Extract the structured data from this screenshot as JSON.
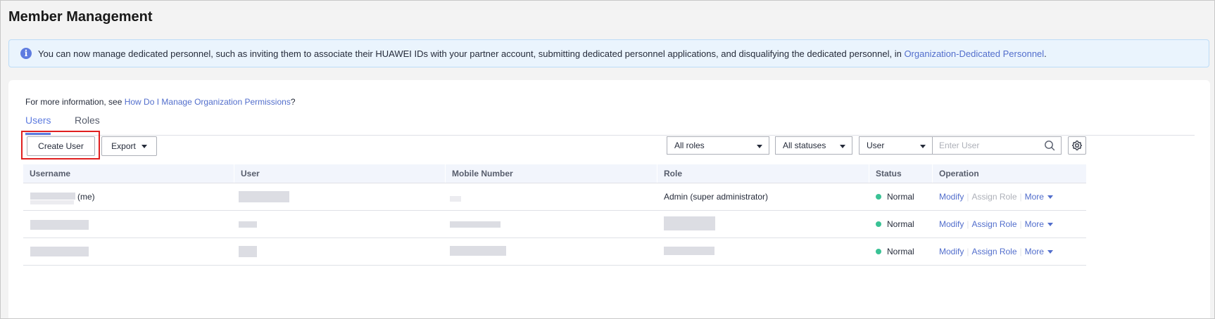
{
  "page": {
    "title": "Member Management"
  },
  "notice": {
    "text": "You can now manage dedicated personnel, such as inviting them to associate their HUAWEI IDs with your partner account, submitting dedicated personnel applications, and disqualifying the dedicated personnel, in ",
    "link": "Organization-Dedicated Personnel",
    "suffix": "."
  },
  "info": {
    "prefix": "For more information, see ",
    "link": "How Do I Manage Organization Permissions",
    "suffix": "?"
  },
  "tabs": [
    {
      "label": "Users",
      "active": true
    },
    {
      "label": "Roles",
      "active": false
    }
  ],
  "toolbar": {
    "create_label": "Create User",
    "export_label": "Export",
    "role_filter": "All roles",
    "status_filter": "All statuses",
    "search_field": "User",
    "search_placeholder": "Enter User"
  },
  "table": {
    "headers": [
      "Username",
      "User",
      "Mobile Number",
      "Role",
      "Status",
      "Operation"
    ],
    "rows": [
      {
        "username_suffix": "(me)",
        "role": "Admin (super administrator)",
        "status": "Normal",
        "op_modify": "Modify",
        "op_assign": "Assign Role",
        "op_assign_disabled": true,
        "op_more": "More"
      },
      {
        "username_suffix": "",
        "role": "",
        "status": "Normal",
        "op_modify": "Modify",
        "op_assign": "Assign Role",
        "op_assign_disabled": false,
        "op_more": "More"
      },
      {
        "username_suffix": "",
        "role": "",
        "status": "Normal",
        "op_modify": "Modify",
        "op_assign": "Assign Role",
        "op_assign_disabled": false,
        "op_more": "More"
      }
    ]
  },
  "colors": {
    "accent": "#5e7ce0",
    "link": "#526ecc",
    "status_normal": "#3ac295",
    "highlight": "#e02020"
  }
}
